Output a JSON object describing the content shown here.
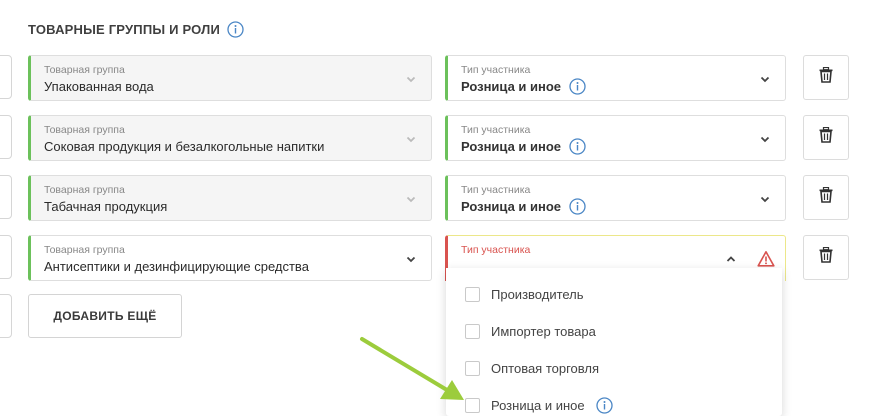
{
  "section": {
    "title": "ТОВАРНЫЕ ГРУППЫ И РОЛИ"
  },
  "rows": [
    {
      "group_label": "Товарная группа",
      "group_value": "Упакованная вода",
      "role_label": "Тип участника",
      "role_value": "Розница и иное"
    },
    {
      "group_label": "Товарная группа",
      "group_value": "Соковая продукция и безалкогольные напитки",
      "role_label": "Тип участника",
      "role_value": "Розница и иное"
    },
    {
      "group_label": "Товарная группа",
      "group_value": "Табачная продукция",
      "role_label": "Тип участника",
      "role_value": "Розница и иное"
    },
    {
      "group_label": "Товарная группа",
      "group_value": "Антисептики и дезинфицирующие средства",
      "role_label": "Тип участника",
      "role_value": ""
    }
  ],
  "add_button": {
    "label": "ДОБАВИТЬ ЕЩЁ"
  },
  "dropdown": {
    "options": [
      {
        "label": "Производитель",
        "checked": false
      },
      {
        "label": "Импортер товара",
        "checked": false
      },
      {
        "label": "Оптовая торговля",
        "checked": false
      },
      {
        "label": "Розница и иное",
        "checked": false
      }
    ]
  },
  "colors": {
    "valid": "#6cc15b",
    "error": "#d9534f",
    "info": "#4a86c5",
    "arrow": "#9ccc3c"
  },
  "icons": [
    "info-icon",
    "chevron-down-icon",
    "chevron-up-icon",
    "warning-icon",
    "trash-icon",
    "arrow-icon"
  ]
}
